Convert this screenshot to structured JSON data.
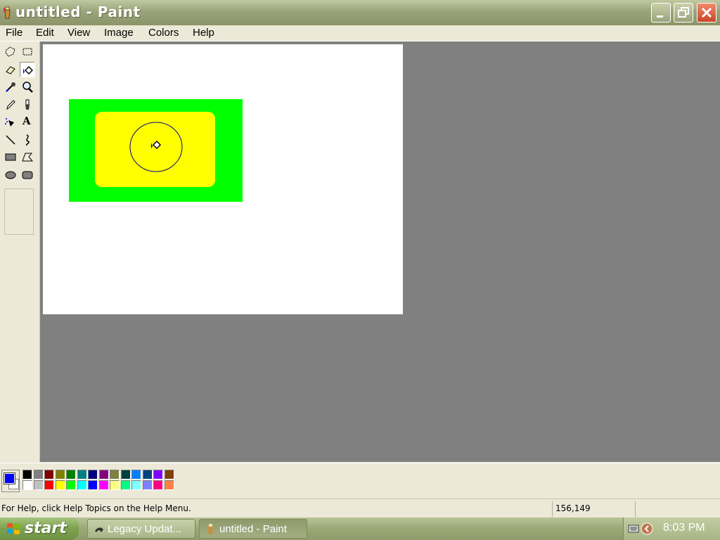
{
  "window": {
    "title": "untitled - Paint"
  },
  "menu": [
    "File",
    "Edit",
    "View",
    "Image",
    "Colors",
    "Help"
  ],
  "tools": [
    "free-form-select",
    "select",
    "eraser",
    "fill-with-color",
    "pick-color",
    "magnifier",
    "pencil",
    "brush",
    "airbrush",
    "text",
    "line",
    "curve",
    "rectangle",
    "polygon",
    "ellipse",
    "rounded-rectangle"
  ],
  "selected_tool": "fill-with-color",
  "text_tool_glyph": "A",
  "colors": {
    "foreground": "#0000ff",
    "background": "#ffffff",
    "palette_top": [
      "#000000",
      "#808080",
      "#800000",
      "#808000",
      "#008000",
      "#008080",
      "#000080",
      "#800080",
      "#808040",
      "#004040",
      "#0080ff",
      "#004080",
      "#8000ff",
      "#804000"
    ],
    "palette_bottom": [
      "#ffffff",
      "#c0c0c0",
      "#ff0000",
      "#ffff00",
      "#00ff00",
      "#00ffff",
      "#0000ff",
      "#ff00ff",
      "#ffff80",
      "#00ff80",
      "#80ffff",
      "#8080ff",
      "#ff0080",
      "#ff8040"
    ]
  },
  "canvas": {
    "outer_rect_color": "#00ff00",
    "inner_rect_color": "#ffff00",
    "circle_stroke": "#000080"
  },
  "status": {
    "help_text": "For Help, click Help Topics on the Help Menu.",
    "coords": "156,149"
  },
  "taskbar": {
    "start_label": "start",
    "tasks": [
      {
        "label": "Legacy Updat...",
        "active": false
      },
      {
        "label": "untitled - Paint",
        "active": true
      }
    ],
    "clock": "8:03 PM"
  }
}
